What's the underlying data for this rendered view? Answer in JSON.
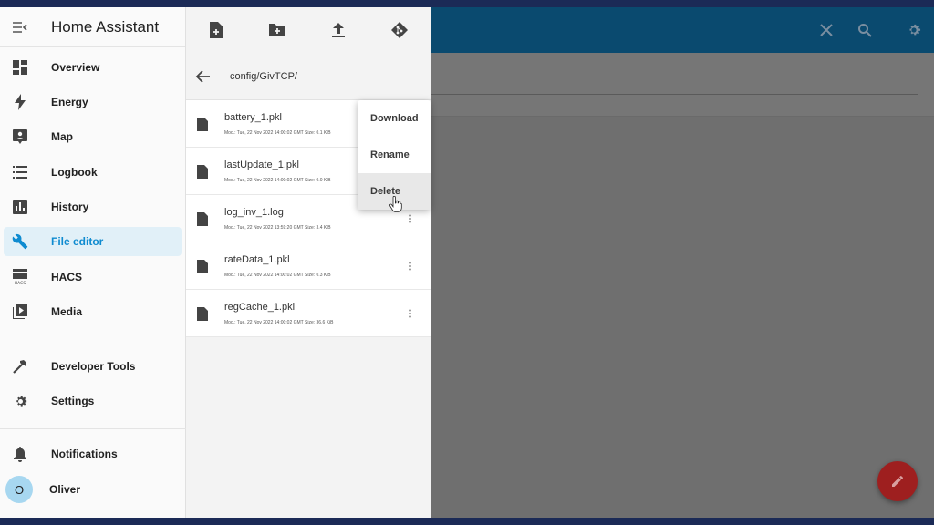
{
  "sidebar": {
    "title": "Home Assistant",
    "items": [
      {
        "label": "Overview",
        "icon": "dashboard-icon"
      },
      {
        "label": "Energy",
        "icon": "lightning-icon"
      },
      {
        "label": "Map",
        "icon": "map-icon"
      },
      {
        "label": "Logbook",
        "icon": "logbook-icon"
      },
      {
        "label": "History",
        "icon": "history-chart-icon"
      },
      {
        "label": "File editor",
        "icon": "wrench-icon"
      },
      {
        "label": "HACS",
        "icon": "hacs-icon"
      },
      {
        "label": "Media",
        "icon": "media-icon"
      }
    ],
    "tools": [
      {
        "label": "Developer Tools",
        "icon": "hammer-icon"
      },
      {
        "label": "Settings",
        "icon": "gear-icon"
      }
    ],
    "notifications_label": "Notifications",
    "user": {
      "initial": "O",
      "name": "Oliver"
    },
    "active_item": "File editor",
    "accent_color": "#0f8bd0"
  },
  "file_panel": {
    "path": "config/GivTCP/",
    "files": [
      {
        "name": "battery_1.pkl",
        "meta": "Mod.: Tue, 22 Nov 2022 14:00:02 GMT  Size: 0.1 KiB"
      },
      {
        "name": "lastUpdate_1.pkl",
        "meta": "Mod.: Tue, 22 Nov 2022 14:00:02 GMT  Size: 0.0 KiB"
      },
      {
        "name": "log_inv_1.log",
        "meta": "Mod.: Tue, 22 Nov 2022 13:59:20 GMT  Size: 3.4 KiB"
      },
      {
        "name": "rateData_1.pkl",
        "meta": "Mod.: Tue, 22 Nov 2022 14:00:02 GMT  Size: 0.3 KiB"
      },
      {
        "name": "regCache_1.pkl",
        "meta": "Mod.: Tue, 22 Nov 2022 14:00:02 GMT  Size: 36.6 KiB"
      }
    ]
  },
  "context_menu": {
    "items": [
      "Download",
      "Rename",
      "Delete"
    ],
    "hovered": "Delete"
  },
  "colors": {
    "header_blue": "#0a4a6f",
    "fab_red": "#9e1f1f"
  }
}
